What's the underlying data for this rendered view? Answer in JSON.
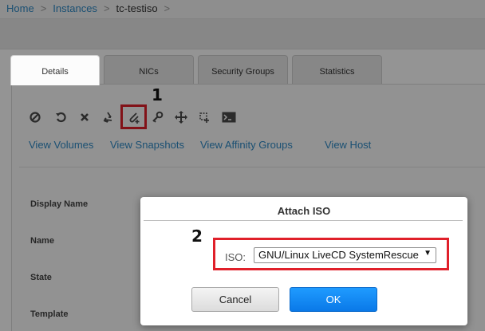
{
  "breadcrumb": {
    "home": "Home",
    "sep1": ">",
    "instances": "Instances",
    "sep2": ">",
    "current": "tc-testiso",
    "sep3": ">"
  },
  "tabs": [
    {
      "label": "Details"
    },
    {
      "label": "NICs"
    },
    {
      "label": "Security Groups"
    },
    {
      "label": "Statistics"
    }
  ],
  "toolbar": {
    "icons": [
      "stop-icon",
      "reboot-icon",
      "destroy-icon",
      "reinstall-icon",
      "attach-iso-icon",
      "reset-password-icon",
      "migrate-icon",
      "scale-icon",
      "console-icon"
    ]
  },
  "links": {
    "view_volumes": "View Volumes",
    "view_snapshots": "View Snapshots",
    "view_affinity_groups": "View Affinity Groups",
    "view_host": "View Host"
  },
  "fields": {
    "display_name": "Display Name",
    "name": "Name",
    "state": "State",
    "template": "Template"
  },
  "annotations": {
    "step1": "1",
    "step2": "2",
    "highlight_color": "#e0202a"
  },
  "dialog": {
    "title": "Attach ISO",
    "iso_label": "ISO:",
    "iso_selected": "GNU/Linux LiveCD SystemRescue",
    "cancel_label": "Cancel",
    "ok_label": "OK"
  },
  "colors": {
    "link": "#2f8ac6",
    "ok_button": "#0a79e8"
  }
}
